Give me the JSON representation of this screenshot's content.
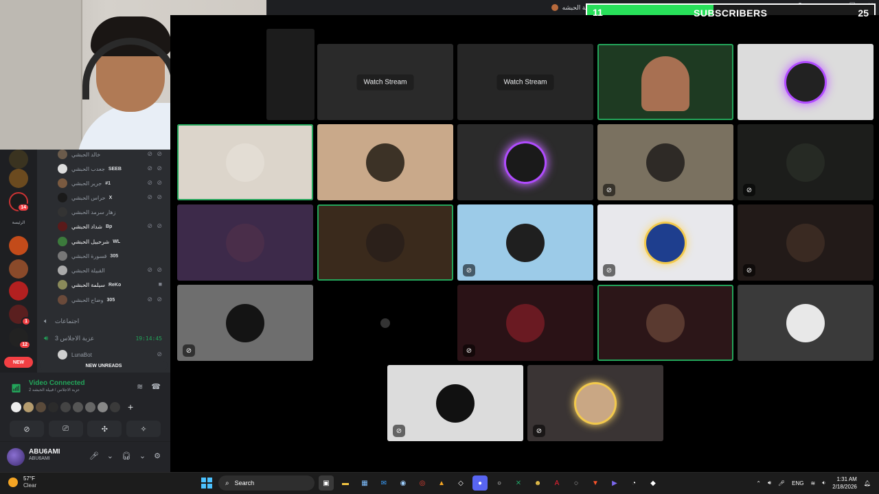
{
  "window": {
    "title": "قبيلة الحبشه"
  },
  "subscribers": {
    "count": "11",
    "label": "SUBSCRIBERS",
    "goal": "25",
    "progress": 0.44
  },
  "rail": {
    "label": "الرئيسة",
    "badges": [
      "14",
      "1",
      "12"
    ],
    "new_pill": "NEW"
  },
  "members": [
    {
      "name": "خالد الحبشي",
      "tag": ""
    },
    {
      "name": "جعدب الحبشي",
      "tag": "SEEB"
    },
    {
      "name": "جرير الحبشي",
      "tag": "#1"
    },
    {
      "name": "حراس الحبشي",
      "tag": "X"
    },
    {
      "name": "زهار سرمد الحبشي",
      "tag": ""
    },
    {
      "name": "شداد الحبشي",
      "tag": "Bp"
    },
    {
      "name": "شرحبيل الحبشي",
      "tag": "WL"
    },
    {
      "name": "قسورة الحبشي",
      "tag": "305"
    },
    {
      "name": "القبيلة الحبشي",
      "tag": ""
    },
    {
      "name": "سيلمة الحبشي",
      "tag": "ReKo"
    },
    {
      "name": "وضاح الحبشي",
      "tag": "305"
    }
  ],
  "channels": {
    "meetings": "اجتماعات",
    "active": "عزبة الاجلاس 3",
    "timer": "19:14:45",
    "bot": "LunaBot"
  },
  "new_unreads": "NEW UNREADS",
  "voice": {
    "status": "Video Connected",
    "sub": "عزبة الاجلاس / قبيلة الحبشه 2"
  },
  "user": {
    "name": "ABU6AMI",
    "sub": "ABU6AMI"
  },
  "stage": {
    "watch_label": "Watch Stream"
  },
  "taskbar": {
    "temp": "57°F",
    "condition": "Clear",
    "search": "Search",
    "lang": "ENG",
    "time": "1:31 AM",
    "date": "2/18/2026"
  },
  "colors": {
    "accent_green": "#23a55a",
    "sub_fill": "#28e05a",
    "badge_red": "#f23f43"
  }
}
